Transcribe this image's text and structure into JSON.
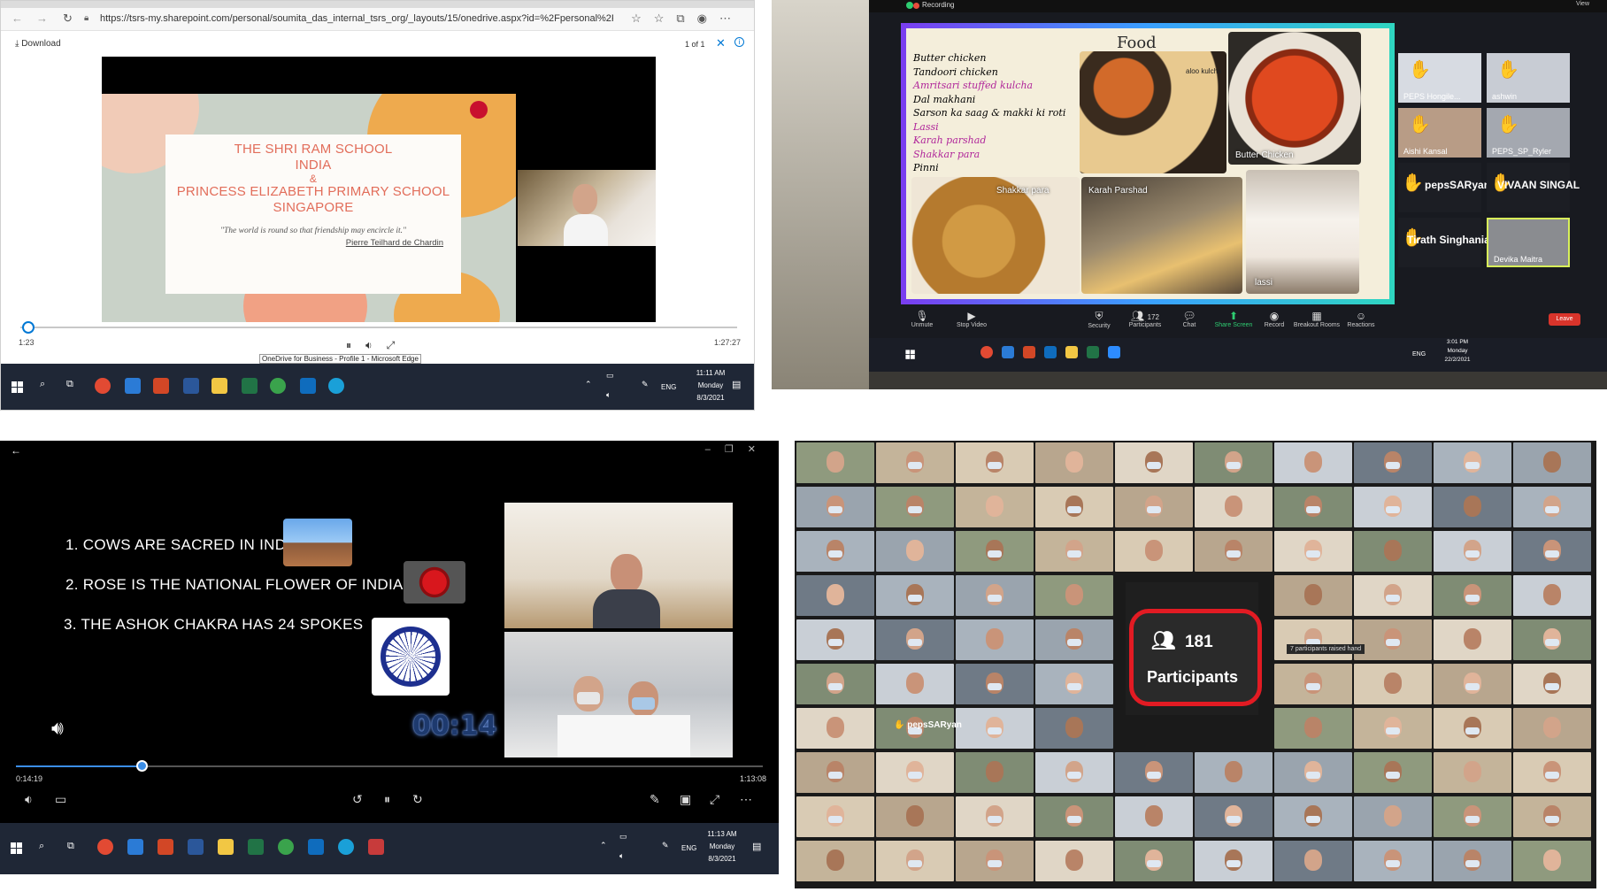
{
  "panel1": {
    "url": "https://tsrs-my.sharepoint.com/personal/soumita_das_internal_tsrs_org/_layouts/15/onedrive.aspx?id=%2Fpersonal%2F...",
    "download_label": "Download",
    "page_count": "1 of 1",
    "slide": {
      "line1": "THE SHRI RAM SCHOOL",
      "line2": "INDIA",
      "line3": "&",
      "line4": "PRINCESS ELIZABETH PRIMARY SCHOOL",
      "line5": "SINGAPORE",
      "quote": "\"The world is round so that friendship may encircle it.\"",
      "author": "Pierre Teilhard de Chardin"
    },
    "time_current": "1:23",
    "time_total": "1:27:27",
    "progress_percent": 1.6,
    "tooltip": "OneDrive for Business - Profile 1 - Microsoft Edge",
    "clock_time": "11:11 AM",
    "clock_day": "Monday",
    "clock_date": "8/3/2021",
    "lang": "ENG",
    "colors": {
      "accent": "#0078d4",
      "slide_title": "#e26d5a",
      "taskbar": "#1f2736"
    }
  },
  "panel2": {
    "recording_label": "Recording",
    "food_title": "Food",
    "food_items": [
      {
        "text": "Butter chicken",
        "color": "#1a1a1a"
      },
      {
        "text": "Tandoori chicken",
        "color": "#1a1a1a"
      },
      {
        "text": "Amritsari stuffed kulcha",
        "color": "#b0269a"
      },
      {
        "text": "Dal makhani",
        "color": "#1a1a1a"
      },
      {
        "text": "Sarson ka saag & makki ki roti",
        "color": "#1a1a1a"
      },
      {
        "text": "Lassi",
        "color": "#b0269a"
      },
      {
        "text": "Karah parshad",
        "color": "#b0269a"
      },
      {
        "text": "Shakkar para",
        "color": "#b0269a"
      },
      {
        "text": "Pinni",
        "color": "#1a1a1a"
      }
    ],
    "labels": {
      "aloo": "aloo kulcha",
      "butter": "Butter Chicken",
      "shakkar": "Shakkar para",
      "karah": "Karah Parshad",
      "lassi": "lassi"
    },
    "participants": [
      {
        "name": "PEPS Hongile..."
      },
      {
        "name": "ashwin"
      },
      {
        "name": "Aishi Kansal"
      },
      {
        "name": "PEPS_SP_Ryler"
      },
      {
        "name": "pepsSARyan"
      },
      {
        "name": "VIVAAN SINGAL"
      },
      {
        "name": "Tirath Singhania"
      },
      {
        "name": "Devika Maitra"
      }
    ],
    "toolbar": [
      {
        "label": "Unmute",
        "icon": "mic-icon"
      },
      {
        "label": "Stop Video",
        "icon": "video-icon"
      },
      {
        "label": "Security",
        "icon": "shield-icon"
      },
      {
        "label": "Participants",
        "icon": "people-icon",
        "count": "172"
      },
      {
        "label": "Chat",
        "icon": "chat-icon"
      },
      {
        "label": "Share Screen",
        "icon": "share-icon"
      },
      {
        "label": "Record",
        "icon": "record-icon"
      },
      {
        "label": "Breakout Rooms",
        "icon": "grid-icon"
      },
      {
        "label": "Reactions",
        "icon": "smile-icon"
      }
    ],
    "leave_label": "Leave",
    "view_label": "View",
    "clock_time": "3:01 PM",
    "clock_day": "Monday",
    "clock_date": "22/2/2021",
    "lang": "ENG"
  },
  "panel3": {
    "facts": [
      "1. COWS ARE SACRED IN INDIA",
      "2. ROSE IS THE NATIONAL FLOWER OF INDIA",
      "3. THE ASHOK CHAKRA HAS 24 SPOKES"
    ],
    "timer": "00:14",
    "time_current": "0:14:19",
    "time_total": "1:13:08",
    "progress_percent": 16.8,
    "clock_time": "11:13 AM",
    "clock_day": "Monday",
    "clock_date": "8/3/2021",
    "lang": "ENG",
    "colors": {
      "seek": "#3b8ee8",
      "timer": "#1e3a6e"
    }
  },
  "panel4": {
    "participants_count": "181",
    "participants_label": "Participants",
    "raised_hand_note": "7 participants raised hand",
    "hand_name": "pepsSARyan",
    "colors": {
      "ring": "#e21b23"
    }
  }
}
